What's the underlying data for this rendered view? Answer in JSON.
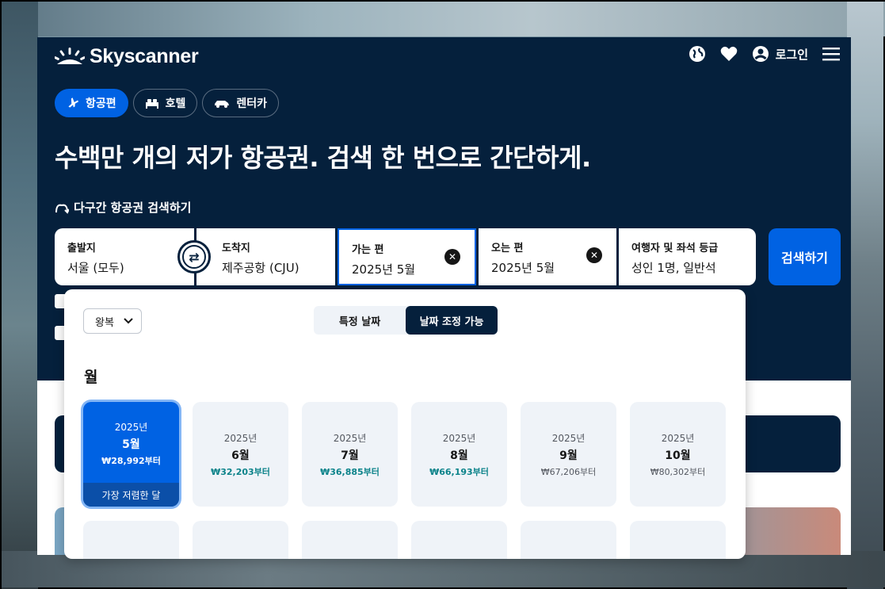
{
  "brand": {
    "name": "Skyscanner"
  },
  "header": {
    "login_label": "로그인"
  },
  "tabs": [
    {
      "label": "항공편",
      "icon": "plane-icon",
      "active": true
    },
    {
      "label": "호텔",
      "icon": "bed-icon",
      "active": false
    },
    {
      "label": "렌터카",
      "icon": "car-icon",
      "active": false
    }
  ],
  "headline": "수백만 개의 저가 항공권. 검색 한 번으로 간단하게.",
  "multicity_label": "다구간 항공권 검색하기",
  "search": {
    "origin": {
      "label": "출발지",
      "value": "서울 (모두)"
    },
    "destination": {
      "label": "도착지",
      "value": "제주공항 (CJU)"
    },
    "depart": {
      "label": "가는 편",
      "value": "2025년 5월"
    },
    "return": {
      "label": "오는 편",
      "value": "2025년 5월"
    },
    "travellers": {
      "label": "여행자 및 좌석 등급",
      "value": "성인 1명, 일반석"
    },
    "button_label": "검색하기"
  },
  "picker": {
    "trip_type": "왕복",
    "mode_specific": "특정 날짜",
    "mode_flexible": "날짜 조정 가능",
    "section_title": "월",
    "cheapest_badge": "가장 저렴한 달",
    "months": [
      {
        "year": "2025년",
        "month": "5월",
        "price": "₩28,992부터",
        "selected": true
      },
      {
        "year": "2025년",
        "month": "6월",
        "price": "₩32,203부터"
      },
      {
        "year": "2025년",
        "month": "7월",
        "price": "₩36,885부터"
      },
      {
        "year": "2025년",
        "month": "8월",
        "price": "₩66,193부터"
      },
      {
        "year": "2025년",
        "month": "9월",
        "price": "₩67,206부터"
      },
      {
        "year": "2025년",
        "month": "10월",
        "price": "₩80,302부터"
      }
    ]
  },
  "colors": {
    "navy": "#05203c",
    "blue": "#0062e3",
    "teal": "#0c838a"
  }
}
